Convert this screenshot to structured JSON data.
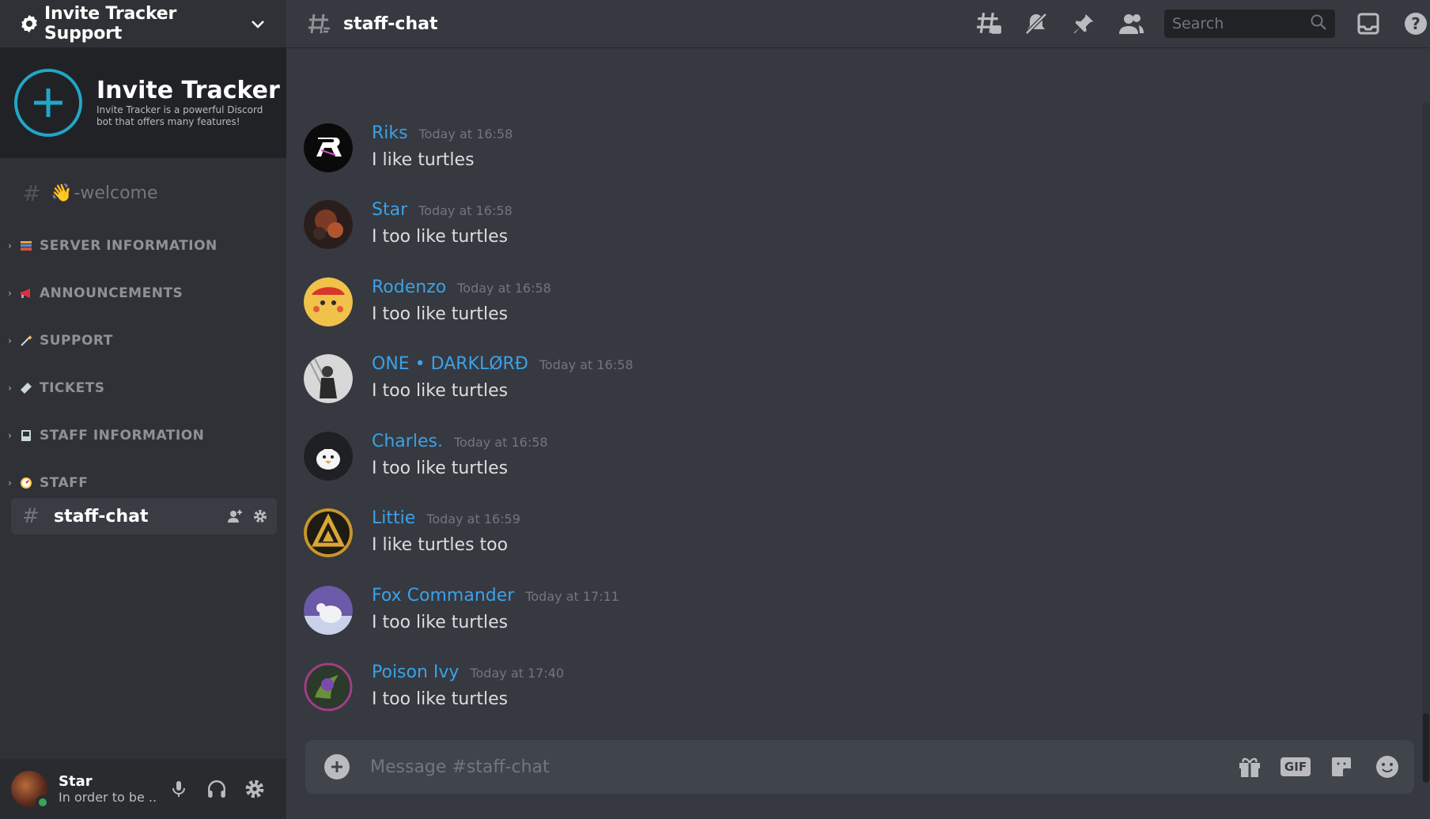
{
  "server": {
    "name": "Invite Tracker Support",
    "banner_title": "Invite Tracker",
    "banner_desc": "Invite Tracker is a powerful Discord bot that offers many features!"
  },
  "channels": {
    "welcome": "-welcome",
    "welcome_emoji": "👋",
    "categories": [
      {
        "label": "SERVER INFORMATION",
        "icon": "books-icon"
      },
      {
        "label": "ANNOUNCEMENTS",
        "icon": "megaphone-icon"
      },
      {
        "label": "SUPPORT",
        "icon": "wand-icon"
      },
      {
        "label": "TICKETS",
        "icon": "ticket-icon"
      },
      {
        "label": "STAFF INFORMATION",
        "icon": "book-icon"
      },
      {
        "label": "STAFF",
        "icon": "compass-icon"
      }
    ],
    "active": "staff-chat"
  },
  "user": {
    "name": "Star",
    "status": "In order to be ..."
  },
  "topbar": {
    "channel": "staff-chat",
    "search_placeholder": "Search"
  },
  "messages": [
    {
      "author": "Riks",
      "time": "Today at 16:58",
      "text": "I like turtles"
    },
    {
      "author": "Star",
      "time": "Today at 16:58",
      "text": "I too like turtles"
    },
    {
      "author": "Rodenzo",
      "time": "Today at 16:58",
      "text": "I too like turtles"
    },
    {
      "author": "ONE • DARKLØRÐ",
      "time": "Today at 16:58",
      "text": "I too like turtles"
    },
    {
      "author": "Charles.",
      "time": "Today at 16:58",
      "text": "I too like turtles"
    },
    {
      "author": "Littie",
      "time": "Today at 16:59",
      "text": "I like turtles too"
    },
    {
      "author": "Fox Commander",
      "time": "Today at 17:11",
      "text": "I too like turtles"
    },
    {
      "author": "Poison Ivy",
      "time": "Today at 17:40",
      "text": "I too like turtles"
    }
  ],
  "composer": {
    "placeholder": "Message #staff-chat",
    "gif_label": "GIF"
  },
  "colors": {
    "accent": "#3ba1e9",
    "online": "#3ba55d",
    "banner_ring": "#21a6c8"
  }
}
